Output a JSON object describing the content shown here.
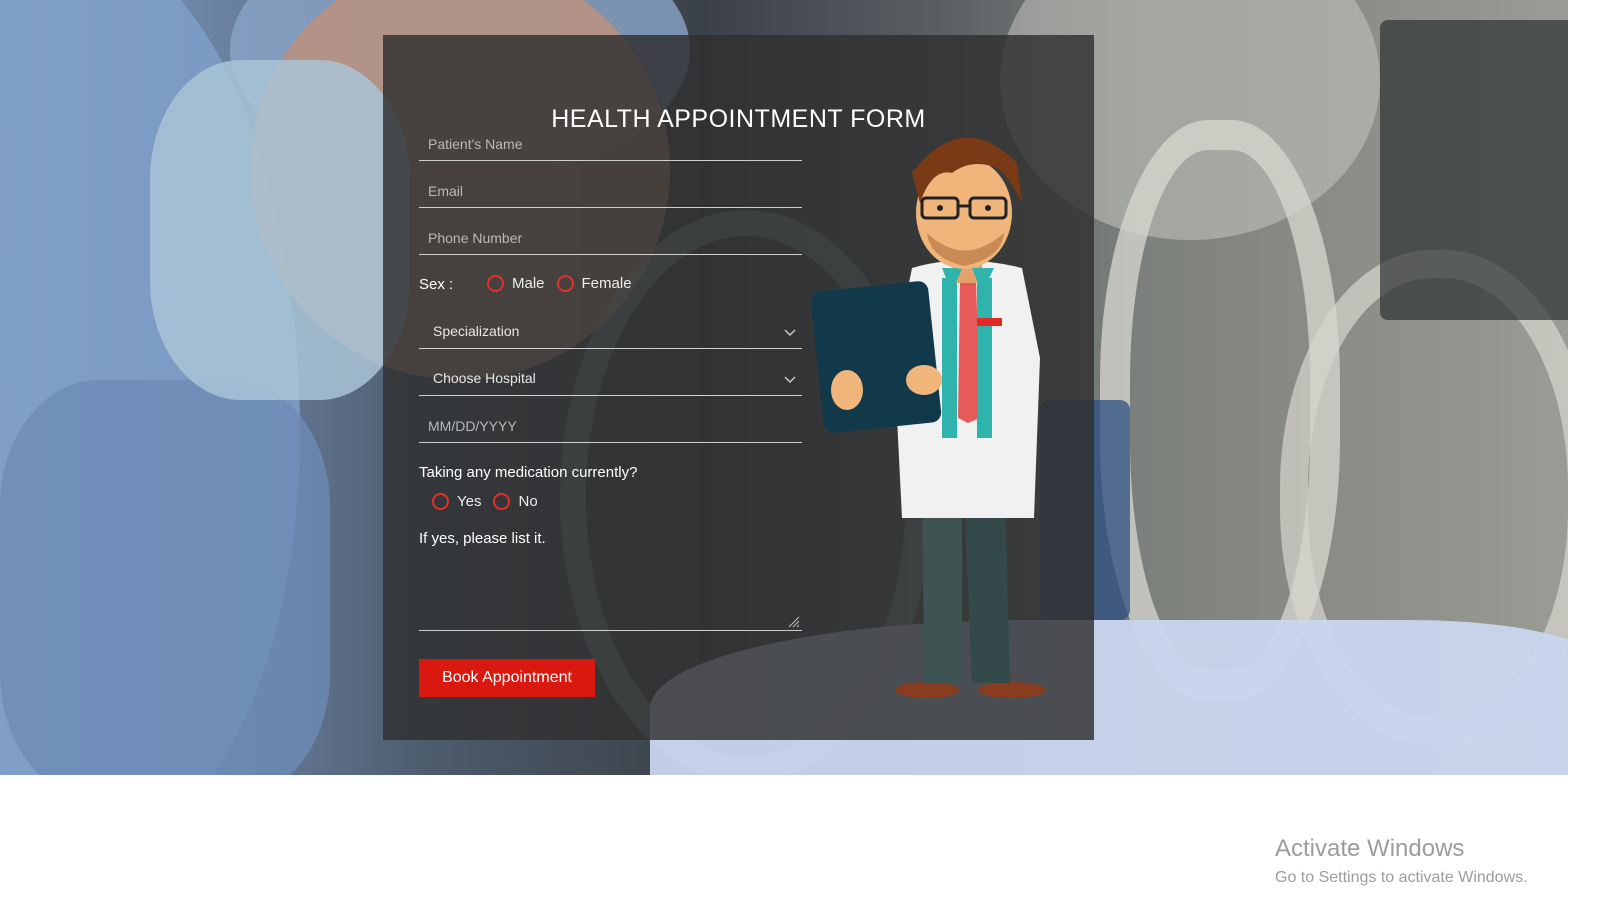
{
  "form": {
    "title": "HEALTH APPOINTMENT FORM",
    "name_placeholder": "Patient's Name",
    "email_placeholder": "Email",
    "phone_placeholder": "Phone Number",
    "sex_label": "Sex :",
    "sex_options": [
      "Male",
      "Female"
    ],
    "specialization_selected": "Specialization",
    "hospital_selected": "Choose Hospital",
    "date_placeholder": "MM/DD/YYYY",
    "medication_question": "Taking any medication currently?",
    "medication_options": [
      "Yes",
      "No"
    ],
    "list_label": "If yes, please list it.",
    "submit_label": "Book Appointment"
  },
  "watermark": {
    "title": "Activate Windows",
    "subtitle": "Go to Settings to activate Windows."
  },
  "colors": {
    "accent": "#d9190f",
    "radio_border": "#e3312a",
    "panel": "#303030"
  },
  "icons": [
    "chevron-down-icon",
    "resize-handle-icon",
    "doctor-illustration"
  ]
}
